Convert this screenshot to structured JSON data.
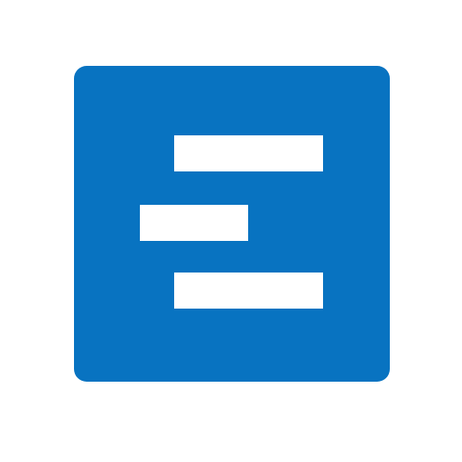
{
  "icon": {
    "name": "gantt-bars-icon",
    "tile_color": "#0873c1",
    "bar_color": "#ffffff"
  }
}
